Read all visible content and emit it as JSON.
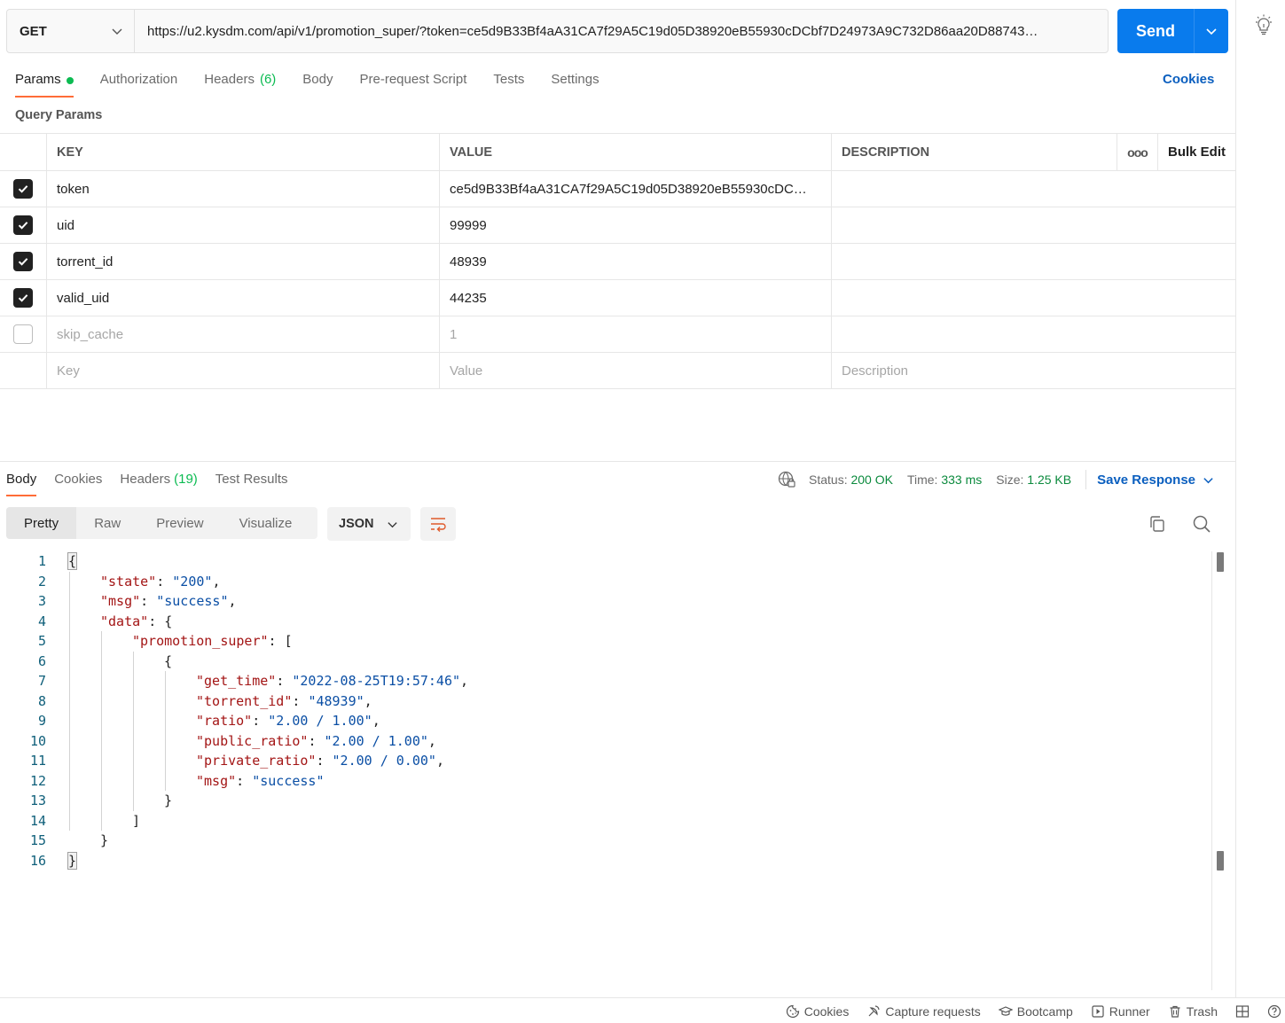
{
  "request": {
    "method": "GET",
    "url": "https://u2.kysdm.com/api/v1/promotion_super/?token=ce5d9B33Bf4aA31CA7f29A5C19d05D38920eB55930cDCbf7D24973A9C732D86aa20D88743…",
    "send_label": "Send"
  },
  "req_tabs": [
    {
      "label": "Params",
      "active": true,
      "dot": true
    },
    {
      "label": "Authorization"
    },
    {
      "label": "Headers",
      "count": "(6)"
    },
    {
      "label": "Body"
    },
    {
      "label": "Pre-request Script"
    },
    {
      "label": "Tests"
    },
    {
      "label": "Settings"
    }
  ],
  "cookies_link": "Cookies",
  "query_params_label": "Query Params",
  "params_table": {
    "headers": {
      "key": "KEY",
      "value": "VALUE",
      "description": "DESCRIPTION",
      "more": "ooo",
      "bulk_edit": "Bulk Edit"
    },
    "rows": [
      {
        "checked": true,
        "key": "token",
        "value": "ce5d9B33Bf4aA31CA7f29A5C19d05D38920eB55930cDC…",
        "description": ""
      },
      {
        "checked": true,
        "key": "uid",
        "value": "99999",
        "description": ""
      },
      {
        "checked": true,
        "key": "torrent_id",
        "value": "48939",
        "description": ""
      },
      {
        "checked": true,
        "key": "valid_uid",
        "value": "44235",
        "description": ""
      },
      {
        "checked": false,
        "key": "skip_cache",
        "value": "1",
        "description": ""
      }
    ],
    "placeholder": {
      "key": "Key",
      "value": "Value",
      "description": "Description"
    }
  },
  "resp_tabs": [
    {
      "label": "Body",
      "active": true
    },
    {
      "label": "Cookies"
    },
    {
      "label": "Headers",
      "count": "(19)"
    },
    {
      "label": "Test Results"
    }
  ],
  "status": {
    "status_label": "Status:",
    "status_value": "200 OK",
    "time_label": "Time:",
    "time_value": "333 ms",
    "size_label": "Size:",
    "size_value": "1.25 KB",
    "save_response": "Save Response"
  },
  "view_modes": [
    "Pretty",
    "Raw",
    "Preview",
    "Visualize"
  ],
  "format": "JSON",
  "code_lines": [
    {
      "n": "1",
      "indent": 0,
      "parts": [
        [
          "p",
          "{"
        ]
      ]
    },
    {
      "n": "2",
      "indent": 1,
      "parts": [
        [
          "k",
          "\"state\""
        ],
        [
          "p",
          ": "
        ],
        [
          "s",
          "\"200\""
        ],
        [
          "p",
          ","
        ]
      ]
    },
    {
      "n": "3",
      "indent": 1,
      "parts": [
        [
          "k",
          "\"msg\""
        ],
        [
          "p",
          ": "
        ],
        [
          "s",
          "\"success\""
        ],
        [
          "p",
          ","
        ]
      ]
    },
    {
      "n": "4",
      "indent": 1,
      "parts": [
        [
          "k",
          "\"data\""
        ],
        [
          "p",
          ": {"
        ]
      ]
    },
    {
      "n": "5",
      "indent": 2,
      "parts": [
        [
          "k",
          "\"promotion_super\""
        ],
        [
          "p",
          ": ["
        ]
      ]
    },
    {
      "n": "6",
      "indent": 3,
      "parts": [
        [
          "p",
          "{"
        ]
      ]
    },
    {
      "n": "7",
      "indent": 4,
      "parts": [
        [
          "k",
          "\"get_time\""
        ],
        [
          "p",
          ": "
        ],
        [
          "s",
          "\"2022-08-25T19:57:46\""
        ],
        [
          "p",
          ","
        ]
      ]
    },
    {
      "n": "8",
      "indent": 4,
      "parts": [
        [
          "k",
          "\"torrent_id\""
        ],
        [
          "p",
          ": "
        ],
        [
          "s",
          "\"48939\""
        ],
        [
          "p",
          ","
        ]
      ]
    },
    {
      "n": "9",
      "indent": 4,
      "parts": [
        [
          "k",
          "\"ratio\""
        ],
        [
          "p",
          ": "
        ],
        [
          "s",
          "\"2.00 / 1.00\""
        ],
        [
          "p",
          ","
        ]
      ]
    },
    {
      "n": "10",
      "indent": 4,
      "parts": [
        [
          "k",
          "\"public_ratio\""
        ],
        [
          "p",
          ": "
        ],
        [
          "s",
          "\"2.00 / 1.00\""
        ],
        [
          "p",
          ","
        ]
      ]
    },
    {
      "n": "11",
      "indent": 4,
      "parts": [
        [
          "k",
          "\"private_ratio\""
        ],
        [
          "p",
          ": "
        ],
        [
          "s",
          "\"2.00 / 0.00\""
        ],
        [
          "p",
          ","
        ]
      ]
    },
    {
      "n": "12",
      "indent": 4,
      "parts": [
        [
          "k",
          "\"msg\""
        ],
        [
          "p",
          ": "
        ],
        [
          "s",
          "\"success\""
        ]
      ]
    },
    {
      "n": "13",
      "indent": 3,
      "parts": [
        [
          "p",
          "}"
        ]
      ]
    },
    {
      "n": "14",
      "indent": 2,
      "parts": [
        [
          "p",
          "]"
        ]
      ]
    },
    {
      "n": "15",
      "indent": 1,
      "parts": [
        [
          "p",
          "}"
        ]
      ]
    },
    {
      "n": "16",
      "indent": 0,
      "parts": [
        [
          "p",
          "}"
        ]
      ]
    }
  ],
  "footer": {
    "cookies": "Cookies",
    "capture": "Capture requests",
    "bootcamp": "Bootcamp",
    "runner": "Runner",
    "trash": "Trash"
  },
  "colors": {
    "accent": "#ff6c37",
    "send": "#097bed",
    "link": "#0b5fbf",
    "ok": "#0b8a3d"
  }
}
